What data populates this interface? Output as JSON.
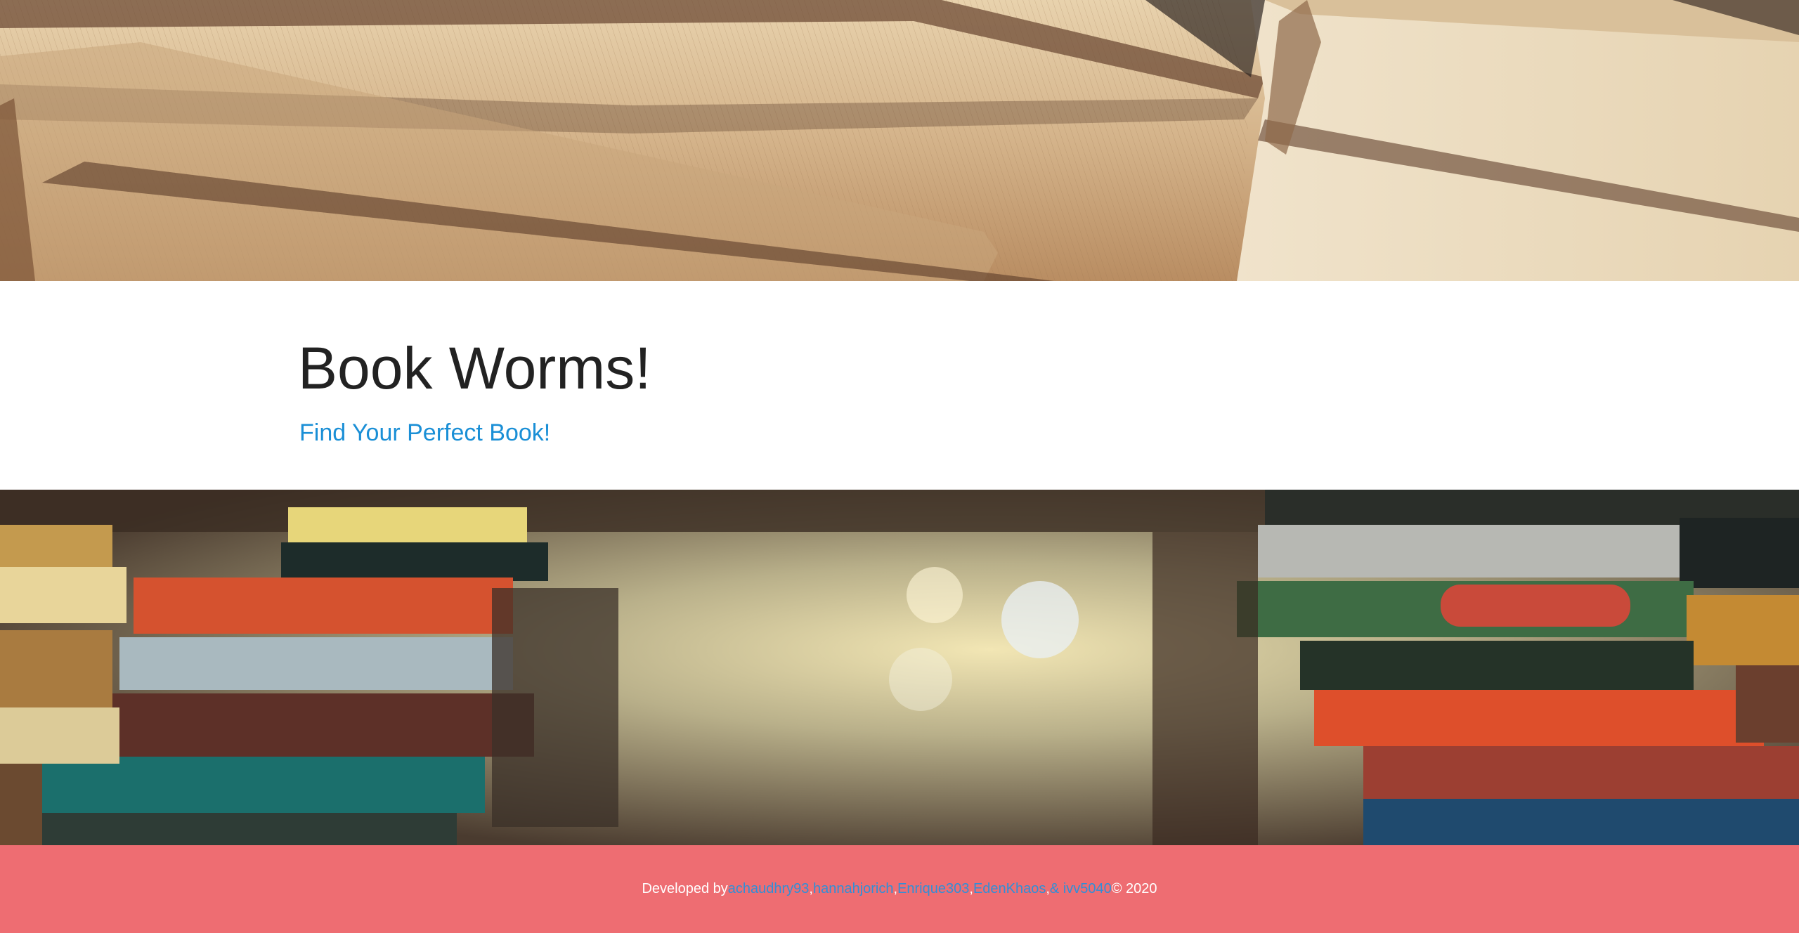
{
  "theme": {
    "footer_bg": "#ee6d72",
    "link_color": "#1a8fd6",
    "footer_link_color": "#2f8fd8",
    "title_color": "#222222"
  },
  "header": {
    "title": "Book Worms!",
    "tagline": "Find Your Perfect Book!"
  },
  "hero_images": {
    "top": "close-up-book-pages-photo",
    "bottom": "library-book-stacks-photo"
  },
  "footer": {
    "prefix": "Developed by ",
    "contributors": [
      "achaudhry93",
      "hannahjorich",
      "Enrique303",
      "EdenKhaos",
      "& ivv5040"
    ],
    "separators": [
      ", ",
      ", ",
      ", ",
      ", "
    ],
    "suffix": " © 2020"
  }
}
